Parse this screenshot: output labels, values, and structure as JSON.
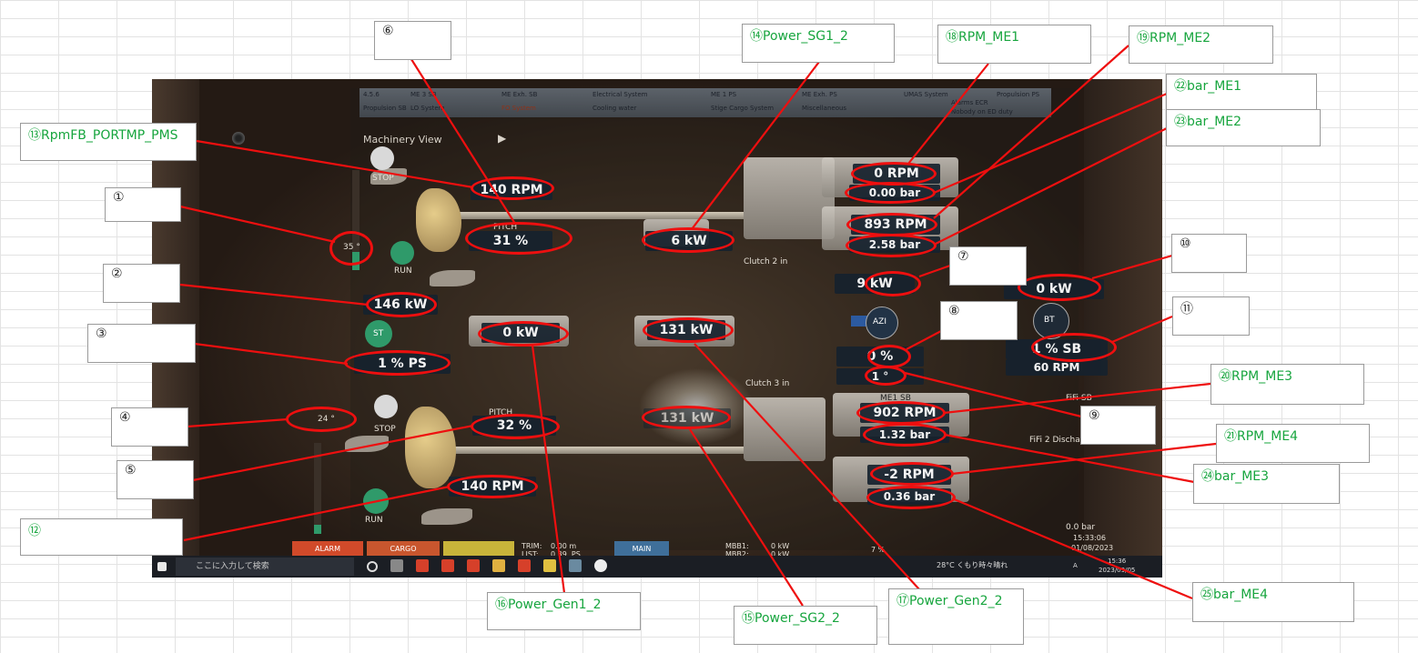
{
  "screen": {
    "title": "Machinery View",
    "topbar_tabs": [
      "4.5.6",
      "ME 3 SB",
      "ME Exh. SB",
      "Electrical System",
      "ME 1 PS",
      "ME Exh. PS",
      "UMAS System",
      "Propulsion PS",
      "Propulsion SB",
      "LO System",
      "FO System",
      "Cooling water",
      "Stige Cargo System",
      "Miscellaneous",
      "Alarms ECR",
      "Nobody on ED duty"
    ],
    "labels": {
      "stop": "STOP",
      "run": "RUN",
      "st": "ST",
      "azi": "AZI",
      "bt": "BT",
      "pitch": "PITCH",
      "clutch2": "Clutch 2 in",
      "clutch3": "Clutch 3 in",
      "fifi": "FiFi 2 Discharge Press",
      "me1sb": "ME1 SB",
      "fifisb": "FiFi SB"
    },
    "values": {
      "angle_1": "35 °",
      "power_ps_thruster": "146 kW",
      "st_ps": "1 %  PS",
      "angle_4": "24 °",
      "pitch_ps": "32 %",
      "pitch_top": "31 %",
      "rpm_fb_port": "140 RPM",
      "rpm_12": "140 RPM",
      "power_sg1_2": "6 kW",
      "power_gen1_2": "0 kW",
      "power_gen2_2": "131 kW",
      "power_sg2_2": "131 kW",
      "power_7": "9 kW",
      "power_10": "0 kW",
      "azi_pct": "0 %",
      "azi_deg": "1 °",
      "bt_sb": "1 %  SB",
      "bt_rpm": "60 RPM",
      "rpm_me1": "0 RPM",
      "bar_me1": "0.00 bar",
      "rpm_me2": "893 RPM",
      "bar_me2": "2.58 bar",
      "rpm_me3": "902 RPM",
      "bar_me3": "1.32 bar",
      "rpm_me4": "-2 RPM",
      "bar_me4": "0.36 bar",
      "fifi_bar": "0.0 bar",
      "clock": "15:33:06",
      "date": "01/08/2023"
    },
    "statusbar": {
      "alarm": "ALARM",
      "cargo": "CARGO",
      "trim": "TRIM:\nLIST:",
      "trim_vals": "0.00 m\n0.39  PS",
      "main": "MAIN",
      "mbb": "MBB1:\nMBB2:",
      "mbb_vals": "0 kW\n0 kW",
      "pct": "7 %"
    },
    "taskbar": {
      "search_placeholder": "ここに入力して検索",
      "weather": "28°C くもり時々晴れ",
      "ime": "A",
      "time": "15:36",
      "date": "2023/09/05"
    }
  },
  "callouts": {
    "c1": "①",
    "c2": "②",
    "c3": "③",
    "c4": "④",
    "c5": "⑤",
    "c6": "⑥",
    "c7": "⑦",
    "c8": "⑧",
    "c9": "⑨",
    "c10": "⑩",
    "c11": "⑪",
    "c12": "⑫",
    "c13": "⑬RpmFB_PORTMP_PMS",
    "c14": "⑭Power_SG1_2",
    "c15": "⑮Power_SG2_2",
    "c16": "⑯Power_Gen1_2",
    "c17": "⑰Power_Gen2_2",
    "c18": "⑱RPM_ME1",
    "c19": "⑲RPM_ME2",
    "c20": "⑳RPM_ME3",
    "c21": "㉑RPM_ME4",
    "c22": "㉒bar_ME1",
    "c23": "㉓bar_ME2",
    "c24": "㉔bar_ME3",
    "c25": "㉕bar_ME4"
  },
  "colors": {
    "annotation_red": "#ee0f0f",
    "callout_green": "#17a53e",
    "readout_bg": "#16222e"
  }
}
